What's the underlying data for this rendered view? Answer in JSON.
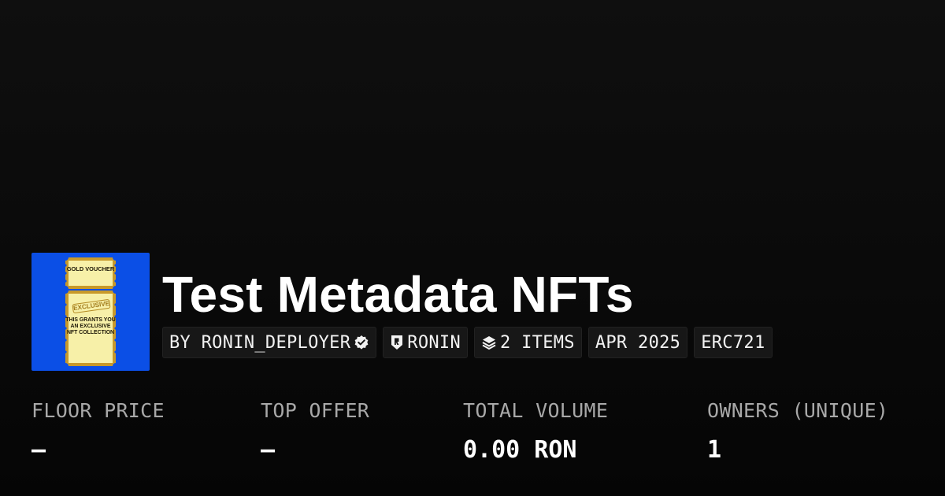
{
  "collection": {
    "title": "Test Metadata NFTs",
    "image": {
      "background_color": "#0b4fe6",
      "ticket_color": "#e0b43a",
      "ticket_top": "GOLD VOUCHER",
      "ticket_stamp": "EXCLUSIVE",
      "ticket_bottom": "THIS GRANTS YOU AN EXCLUSIVE NFT COLLECTION"
    },
    "chips": {
      "creator": "BY RONIN_DEPLOYER",
      "creator_verified_icon": "verified-badge-icon",
      "chain": "RONIN",
      "chain_icon": "ronin-shield-icon",
      "items": "2 ITEMS",
      "items_icon": "layers-icon",
      "date": "APR 2025",
      "standard": "ERC721"
    }
  },
  "stats": [
    {
      "label": "FLOOR PRICE",
      "value": "–"
    },
    {
      "label": "TOP OFFER",
      "value": "–"
    },
    {
      "label": "TOTAL VOLUME",
      "value": "0.00 RON"
    },
    {
      "label": "OWNERS (UNIQUE)",
      "value": "1"
    }
  ],
  "colors": {
    "background": "#0a0a0a",
    "chip_background": "#171717",
    "label_gray": "#a8a8a8",
    "text": "#ffffff"
  }
}
